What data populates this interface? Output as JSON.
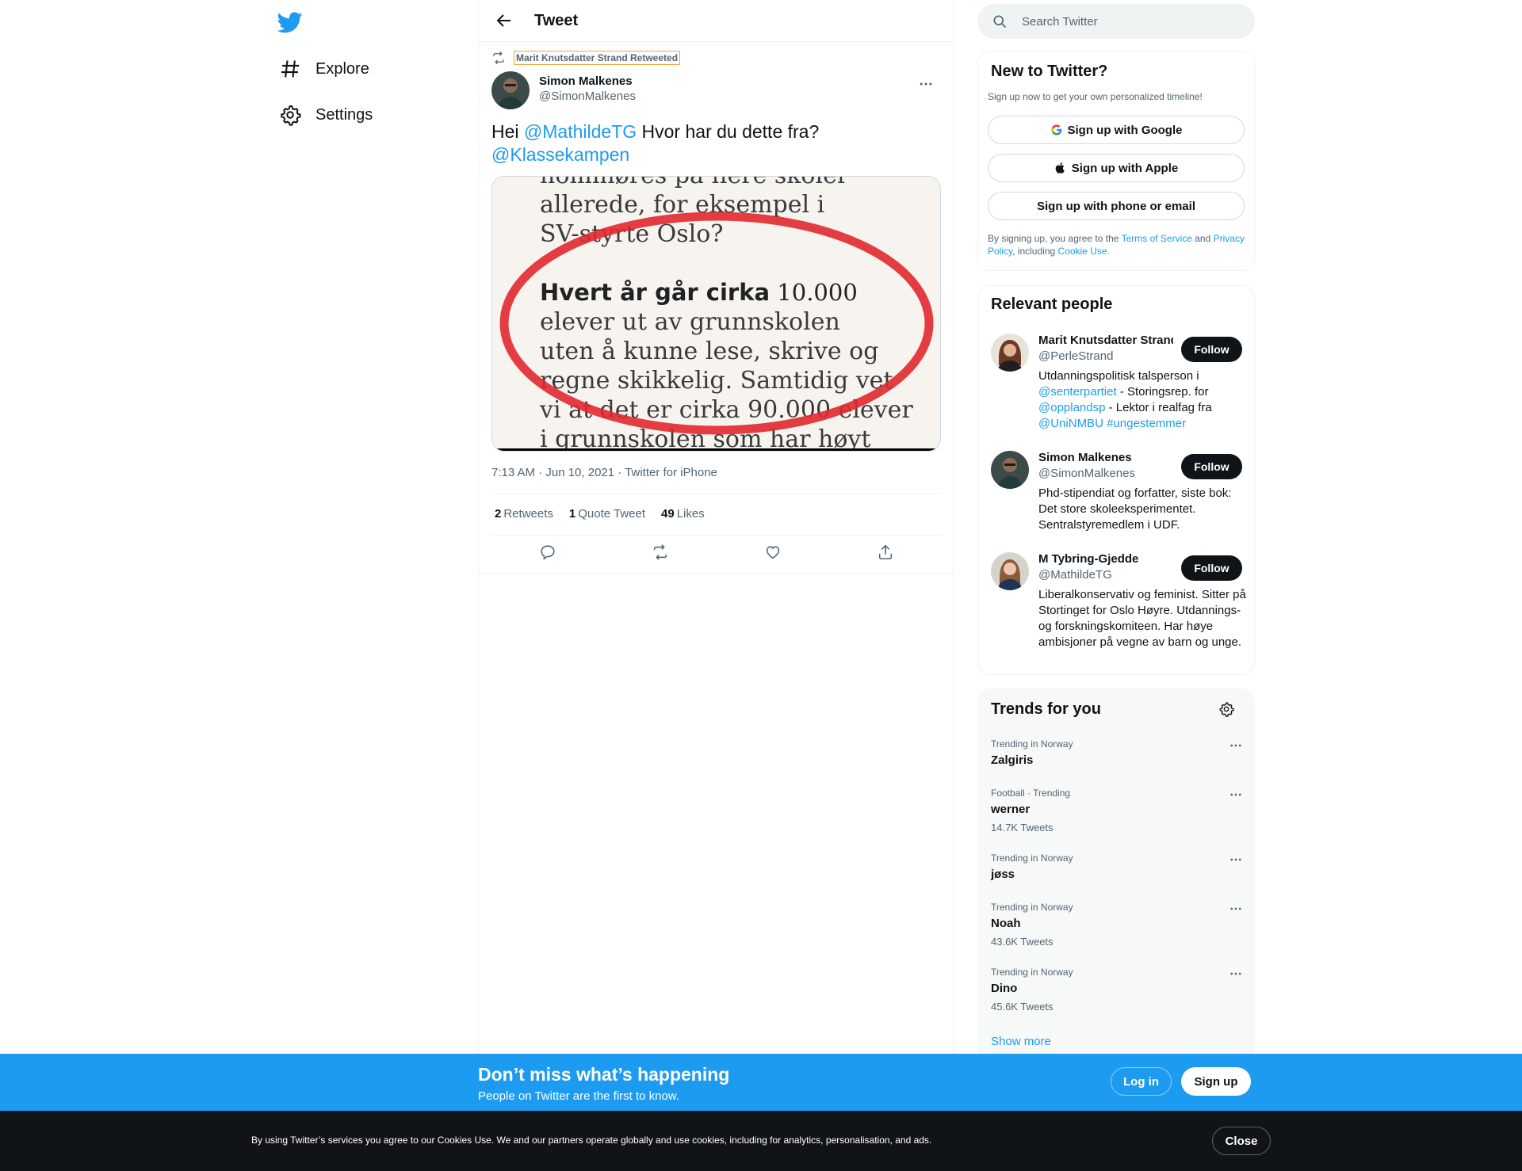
{
  "nav": {
    "items": [
      {
        "label": "Explore",
        "icon": "hashtag-icon"
      },
      {
        "label": "Settings",
        "icon": "gear-icon"
      }
    ]
  },
  "header": {
    "title": "Tweet"
  },
  "tweet": {
    "retweeted_by": "Marit Knutsdatter Strand Retweeted",
    "author_name": "Simon Malkenes",
    "author_handle": "@SimonMalkenes",
    "text_parts": [
      "Hei ",
      "@MathildeTG",
      " Hvor har du dette fra?",
      "@Klassekampen"
    ],
    "media_lines": [
      "nominøres på flere skoler",
      "allerede, for eksempel i",
      "SV-styrte Oslo?",
      "Hvert år går cirka",
      " 10.000",
      "elever ut av grunnskolen",
      "uten å kunne lese, skrive og",
      "regne skikkelig. Samtidig vet",
      "vi at det er cirka 90.000 elever",
      "i grunnskolen som har høyt"
    ],
    "timestamp": "7:13 AM · Jun 10, 2021 · Twitter for iPhone",
    "stats": {
      "retweets_count": "2",
      "retweets_label": "Retweets",
      "quotes_count": "1",
      "quotes_label": "Quote Tweet",
      "likes_count": "49",
      "likes_label": "Likes"
    }
  },
  "search": {
    "placeholder": "Search Twitter"
  },
  "new_to_twitter": {
    "title": "New to Twitter?",
    "subtitle": "Sign up now to get your own personalized timeline!",
    "google_label": "Sign up with Google",
    "apple_label": "Sign up with Apple",
    "phone_label": "Sign up with phone or email",
    "legal_1": "By signing up, you agree to the ",
    "terms": "Terms of Service",
    "legal_2": " and ",
    "privacy": "Privacy Policy",
    "legal_3": ", including ",
    "cookie": "Cookie Use."
  },
  "relevant_people": {
    "title": "Relevant people",
    "follow_label": "Follow",
    "people": [
      {
        "name": "Marit Knutsdatter Strand",
        "handle": "@PerleStrand",
        "bio_parts": [
          "Utdanningspolitisk talsperson i ",
          "@senterpartiet",
          " - Storingsrep. for ",
          "@opplandsp",
          " - Lektor i realfag fra ",
          "@UniNMBU",
          " ",
          "#ungestemmer"
        ]
      },
      {
        "name": "Simon Malkenes",
        "handle": "@SimonMalkenes",
        "bio": "Phd-stipendiat og forfatter, siste bok: Det store skoleeksperimentet. Sentralstyremedlem i UDF."
      },
      {
        "name": "M Tybring-Gjedde",
        "handle": "@MathildeTG",
        "bio": "Liberalkonservativ og feminist. Sitter på Stortinget for Oslo Høyre. Utdannings- og forskningskomiteen. Har høye ambisjoner på vegne av barn og unge."
      }
    ]
  },
  "trends": {
    "title": "Trends for you",
    "items": [
      {
        "context": "Trending in Norway",
        "name": "Zalgiris",
        "count": ""
      },
      {
        "context": "Football · Trending",
        "name": "werner",
        "count": "14.7K Tweets"
      },
      {
        "context": "Trending in Norway",
        "name": "jøss",
        "count": ""
      },
      {
        "context": "Trending in Norway",
        "name": "Noah",
        "count": "43.6K Tweets"
      },
      {
        "context": "Trending in Norway",
        "name": "Dino",
        "count": "45.6K Tweets"
      }
    ],
    "show_more": "Show more"
  },
  "banner": {
    "title": "Don’t miss what’s happening",
    "subtitle": "People on Twitter are the first to know.",
    "login": "Log in",
    "signup": "Sign up"
  },
  "cookie_bar": {
    "text": "By using Twitter’s services you agree to our Cookies Use. We and our partners operate globally and use cookies, including for analytics, personalisation, and ads.",
    "close": "Close"
  },
  "colors": {
    "accent": "#1d9bf0",
    "text": "#0f1419",
    "muted": "#536471",
    "cookie_bg": "#101417"
  }
}
